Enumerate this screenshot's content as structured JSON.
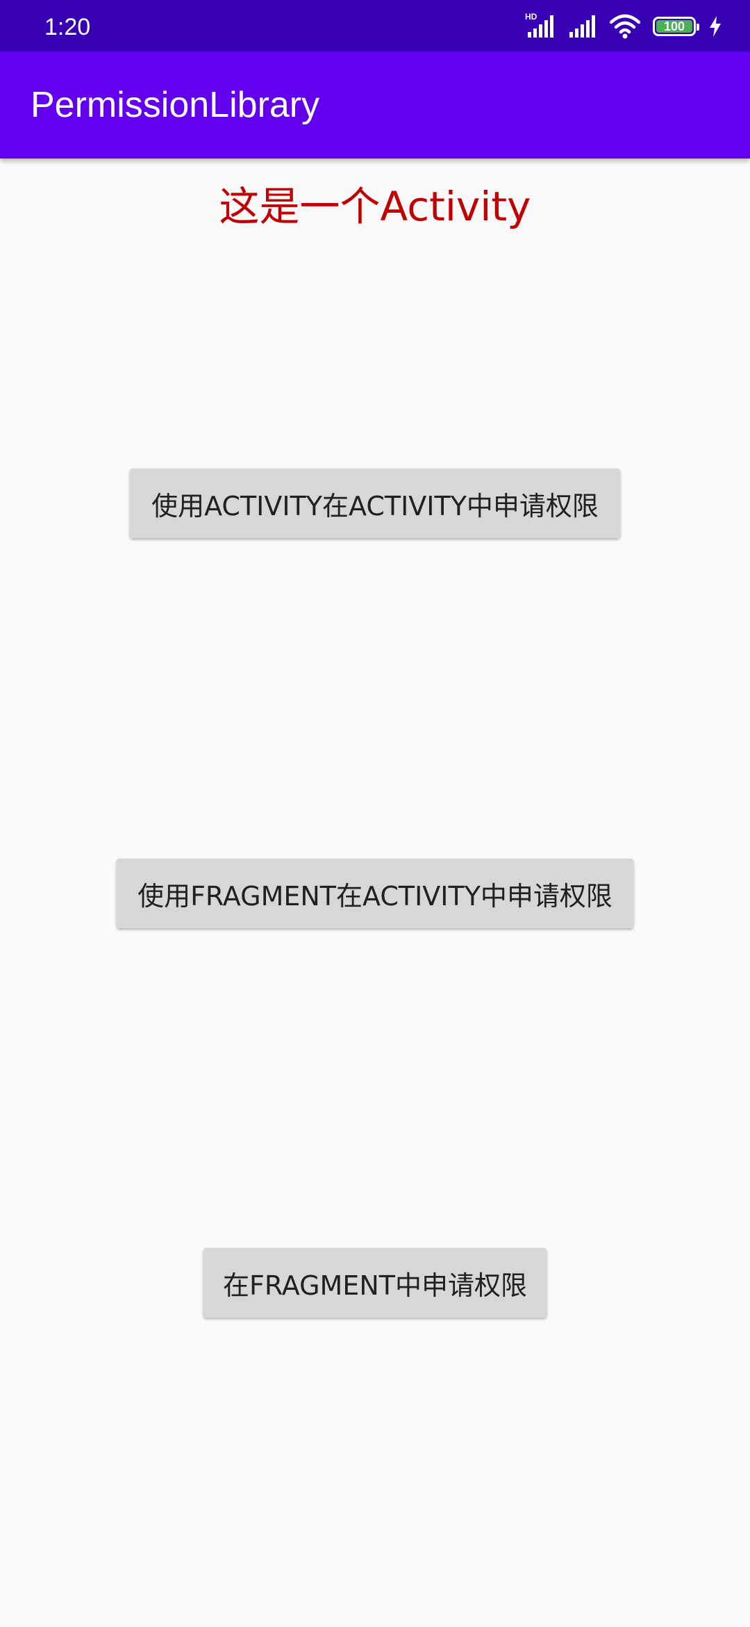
{
  "status_bar": {
    "time": "1:20",
    "hd_label": "HD",
    "battery_level": "100",
    "battery_fill_color": "#4caf50",
    "background_color": "#3700b3"
  },
  "app_bar": {
    "title": "PermissionLibrary",
    "background_color": "#6200ee"
  },
  "main": {
    "activity_label": "这是一个Activity",
    "activity_label_color": "#c00000",
    "buttons": [
      {
        "label": "使用ACTIVITY在ACTIVITY中申请权限"
      },
      {
        "label": "使用FRAGMENT在ACTIVITY中申请权限"
      },
      {
        "label": "在FRAGMENT中申请权限"
      }
    ],
    "button_color": "#d6d7d7"
  },
  "icons": [
    "signal-hd-icon",
    "signal-icon",
    "wifi-icon",
    "battery-icon",
    "charging-bolt-icon"
  ]
}
